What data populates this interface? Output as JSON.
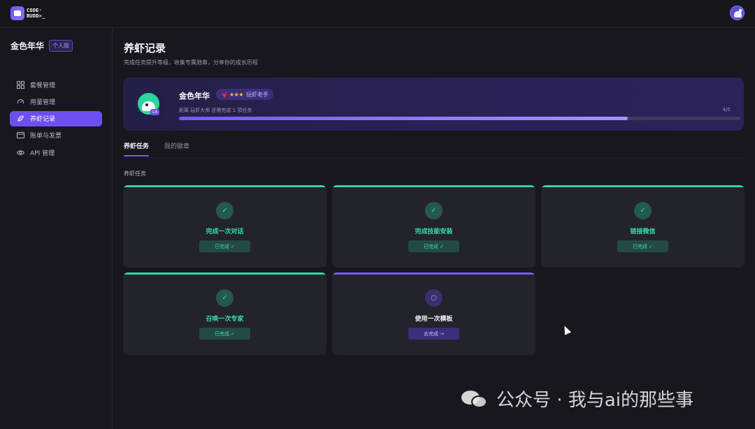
{
  "app": {
    "logo_line1": "CODE·",
    "logo_line2": "BUDD>_"
  },
  "sidebar": {
    "user_name": "金色年华",
    "plan": "个人版",
    "items": [
      {
        "label": "套餐管理",
        "icon": "grid-icon",
        "active": false
      },
      {
        "label": "用量管理",
        "icon": "gauge-icon",
        "active": false
      },
      {
        "label": "养虾记录",
        "icon": "shrimp-icon",
        "active": true
      },
      {
        "label": "账单与发票",
        "icon": "invoice-icon",
        "active": false
      },
      {
        "label": "API 管理",
        "icon": "eye-icon",
        "active": false
      }
    ]
  },
  "header": {
    "title": "养虾记录",
    "subtitle": "完成任务提升等级，收集专属勋章，分享你的成长历程"
  },
  "profile": {
    "name": "金色年华",
    "level_badge": "L4",
    "title_icon": "🦞",
    "title_stars": "★★★",
    "title": "玩虾老手",
    "next_level_text": "距离 玩虾大师 还需完成 1 项任务",
    "progress_text": "4/5",
    "progress_fraction": 0.8
  },
  "tabs": [
    {
      "label": "养虾任务",
      "active": true
    },
    {
      "label": "我的徽章",
      "active": false
    }
  ],
  "section_label": "养虾任务",
  "tasks": [
    {
      "name": "完成一次对话",
      "status": "已完成 ✓",
      "done": true,
      "icon": "✓"
    },
    {
      "name": "完成技能安装",
      "status": "已完成 ✓",
      "done": true,
      "icon": "✓"
    },
    {
      "name": "链接微信",
      "status": "已完成 ✓",
      "done": true,
      "icon": "✓"
    },
    {
      "name": "召唤一次专家",
      "status": "已完成 ✓",
      "done": true,
      "icon": "✓"
    },
    {
      "name": "使用一次模板",
      "status": "去完成 →",
      "done": false,
      "icon": "○"
    }
  ],
  "colors": {
    "accent": "#6d4ff0",
    "done": "#2fd7a3",
    "background": "#17171d",
    "card": "#23232c"
  },
  "watermark": {
    "text": "公众号 · 我与ai的那些事"
  }
}
